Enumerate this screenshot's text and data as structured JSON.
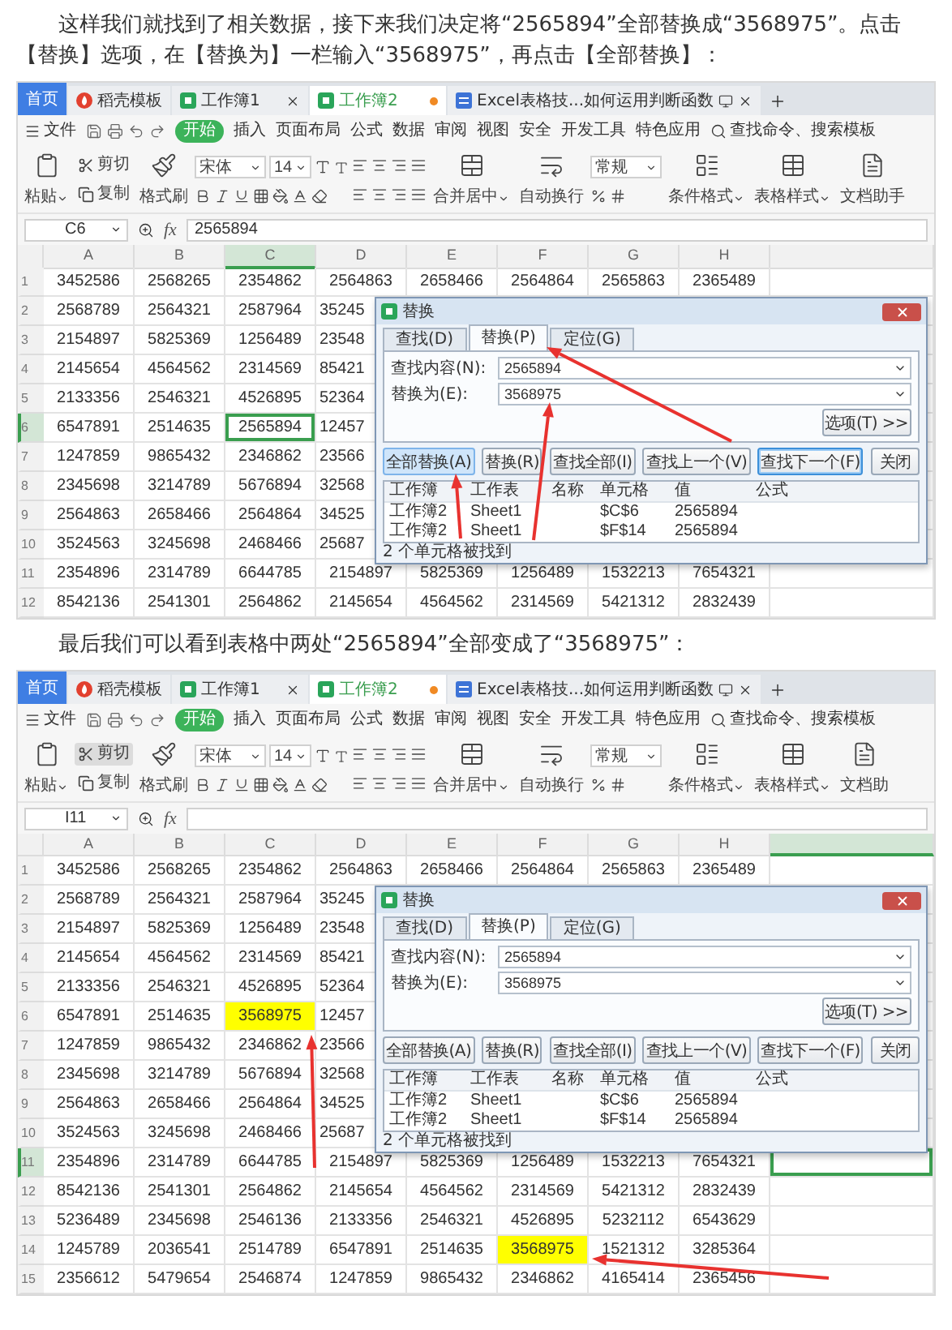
{
  "blocks": [
    {
      "kind": "text",
      "text": "这样我们就找到了相关数据，接下来我们决定将“2565894”全部替换成“3568975”。点击【替换】选项，在【替换为】一栏输入“3568975”，再点击【全部替换】："
    },
    {
      "kind": "screenshot",
      "tabs": [
        {
          "kind": "home",
          "label": "首页",
          "selected": false
        },
        {
          "kind": "docer",
          "label": "稻壳模板",
          "selected": false
        },
        {
          "kind": "sheet",
          "label": "工作簿1",
          "selected": false
        },
        {
          "kind": "sheet",
          "label": "工作簿2",
          "selected": true
        },
        {
          "kind": "doc",
          "label": "Excel表格技...如何运用判断函数",
          "selected": false
        }
      ],
      "menu": {
        "file": "文件",
        "tabs": [
          {
            "label": "开始",
            "selected": true
          },
          {
            "label": "插入",
            "selected": false
          },
          {
            "label": "页面布局",
            "selected": false
          },
          {
            "label": "公式",
            "selected": false
          },
          {
            "label": "数据",
            "selected": false
          },
          {
            "label": "审阅",
            "selected": false
          },
          {
            "label": "视图",
            "selected": false
          },
          {
            "label": "安全",
            "selected": false
          },
          {
            "label": "开发工具",
            "selected": false
          },
          {
            "label": "特色应用",
            "selected": false
          }
        ],
        "search": "查找命令、搜索模板"
      },
      "ribbon": [
        {
          "kind": "big",
          "label": "粘贴",
          "dropdown": true
        },
        {
          "kind": "pair",
          "items": [
            {
              "label": "剪切",
              "hovered": false
            },
            {
              "label": "复制",
              "hovered": false
            }
          ]
        },
        {
          "kind": "big",
          "label": "格式刷",
          "dropdown": false
        },
        {
          "kind": "font",
          "font": "宋体",
          "size": "14"
        },
        {
          "kind": "align"
        },
        {
          "kind": "big",
          "label": "合并居中",
          "dropdown": true
        },
        {
          "kind": "big",
          "label": "自动换行",
          "dropdown": false
        },
        {
          "kind": "number",
          "format": "常规"
        },
        {
          "kind": "big",
          "label": "条件格式",
          "dropdown": true
        },
        {
          "kind": "big",
          "label": "表格样式",
          "dropdown": true
        },
        {
          "kind": "big",
          "label": "文档助手",
          "dropdown": false
        }
      ],
      "name_box": "C6",
      "fx": "fx",
      "formula": "2565894",
      "columns": [
        {
          "label": "A",
          "selected": false
        },
        {
          "label": "B",
          "selected": false
        },
        {
          "label": "C",
          "selected": true
        },
        {
          "label": "D",
          "selected": false
        },
        {
          "label": "E",
          "selected": false
        },
        {
          "label": "F",
          "selected": false
        },
        {
          "label": "G",
          "selected": false
        },
        {
          "label": "H",
          "selected": false
        },
        {
          "selected": false
        }
      ],
      "rows": [
        {
          "label": "1",
          "selected": false,
          "cells": [
            {
              "text": "3452586",
              "selected": false
            },
            {
              "text": "2568265",
              "selected": false
            },
            {
              "text": "2354862",
              "selected": false
            },
            {
              "text": "2564863",
              "selected": false
            },
            {
              "text": "2658466",
              "selected": false
            },
            {
              "text": "2564864",
              "selected": false
            },
            {
              "text": "2565863",
              "selected": false
            },
            {
              "text": "2365489",
              "selected": false
            }
          ]
        },
        {
          "label": "2",
          "selected": false,
          "cells": [
            {
              "text": "2568789",
              "selected": false
            },
            {
              "text": "2564321",
              "selected": false
            },
            {
              "text": "2587964",
              "selected": false
            }
          ],
          "cut_cell": {
            "text": "35245",
            "selected": false
          }
        },
        {
          "label": "3",
          "selected": false,
          "cells": [
            {
              "text": "2154897",
              "selected": false
            },
            {
              "text": "5825369",
              "selected": false
            },
            {
              "text": "1256489",
              "selected": false
            }
          ],
          "cut_cell": {
            "text": "23548",
            "selected": false
          }
        },
        {
          "label": "4",
          "selected": false,
          "cells": [
            {
              "text": "2145654",
              "selected": false
            },
            {
              "text": "4564562",
              "selected": false
            },
            {
              "text": "2314569",
              "selected": false
            }
          ],
          "cut_cell": {
            "text": "85421",
            "selected": false
          }
        },
        {
          "label": "5",
          "selected": false,
          "cells": [
            {
              "text": "2133356",
              "selected": false
            },
            {
              "text": "2546321",
              "selected": false
            },
            {
              "text": "4526895",
              "selected": false
            }
          ],
          "cut_cell": {
            "text": "52364",
            "selected": false
          }
        },
        {
          "label": "6",
          "selected": true,
          "cells": [
            {
              "text": "6547891",
              "selected": false
            },
            {
              "text": "2514635",
              "selected": false
            },
            {
              "text": "2565894",
              "selected": true
            }
          ],
          "cut_cell": {
            "text": "12457",
            "selected": false
          }
        },
        {
          "label": "7",
          "selected": false,
          "cells": [
            {
              "text": "1247859",
              "selected": false
            },
            {
              "text": "9865432",
              "selected": false
            },
            {
              "text": "2346862",
              "selected": false
            }
          ],
          "cut_cell": {
            "text": "23566",
            "selected": false
          }
        },
        {
          "label": "8",
          "selected": false,
          "cells": [
            {
              "text": "2345698",
              "selected": false
            },
            {
              "text": "3214789",
              "selected": false
            },
            {
              "text": "5676894",
              "selected": false
            }
          ],
          "cut_cell": {
            "text": "32568",
            "selected": false
          }
        },
        {
          "label": "9",
          "selected": false,
          "cells": [
            {
              "text": "2564863",
              "selected": false
            },
            {
              "text": "2658466",
              "selected": false
            },
            {
              "text": "2564864",
              "selected": false
            }
          ],
          "cut_cell": {
            "text": "34525",
            "selected": false
          }
        },
        {
          "label": "10",
          "selected": false,
          "cells": [
            {
              "text": "3524563",
              "selected": false
            },
            {
              "text": "3245698",
              "selected": false
            },
            {
              "text": "2468466",
              "selected": false
            }
          ],
          "cut_cell": {
            "text": "25687",
            "selected": false
          }
        },
        {
          "label": "11",
          "selected": false,
          "cells": [
            {
              "text": "2354896",
              "selected": false
            },
            {
              "text": "2314789",
              "selected": false
            },
            {
              "text": "6644785",
              "selected": false
            },
            {
              "text": "2154897",
              "selected": false
            },
            {
              "text": "5825369",
              "selected": false
            },
            {
              "text": "1256489",
              "selected": false
            },
            {
              "text": "1532213",
              "selected": false
            },
            {
              "text": "7654321",
              "selected": false
            }
          ]
        },
        {
          "label": "12",
          "selected": false,
          "cells": [
            {
              "text": "8542136",
              "selected": false
            },
            {
              "text": "2541301",
              "selected": false
            },
            {
              "text": "2564862",
              "selected": false
            },
            {
              "text": "2145654",
              "selected": false
            },
            {
              "text": "4564562",
              "selected": false
            },
            {
              "text": "2314569",
              "selected": false
            },
            {
              "text": "5421312",
              "selected": false
            },
            {
              "text": "2832439",
              "selected": false
            }
          ]
        }
      ],
      "dialog": {
        "title": "替换",
        "tabs": [
          {
            "label": "查找(D)",
            "selected": false
          },
          {
            "label": "替换(P)",
            "selected": true
          },
          {
            "label": "定位(G)",
            "selected": false
          }
        ],
        "fields": [
          {
            "label": "查找内容(N):",
            "value": "2565894"
          },
          {
            "label": "替换为(E):",
            "value": "3568975"
          }
        ],
        "options": "选项(T) >>",
        "buttons": [
          {
            "label": "全部替换(A)",
            "hovered": true,
            "focused": false
          },
          {
            "label": "替换(R)",
            "hovered": false,
            "focused": false
          },
          {
            "label": "查找全部(I)",
            "hovered": false,
            "focused": false
          },
          {
            "label": "查找上一个(V)",
            "hovered": false,
            "focused": false
          },
          {
            "label": "查找下一个(F)",
            "hovered": false,
            "focused": true
          },
          {
            "label": "关闭",
            "hovered": false,
            "focused": false
          }
        ],
        "result_columns": [
          "工作簿",
          "工作表",
          "名称",
          "单元格",
          "值",
          "公式"
        ],
        "results": [
          {
            "workbook": "工作簿2",
            "sheet": "Sheet1",
            "cell": "$C$6",
            "value": "2565894"
          },
          {
            "workbook": "工作簿2",
            "sheet": "Sheet1",
            "cell": "$F$14",
            "value": "2565894"
          }
        ],
        "status": "2 个单元格被找到"
      }
    },
    {
      "kind": "text",
      "text": "最后我们可以看到表格中两处“2565894”全部变成了“3568975”："
    },
    {
      "kind": "screenshot",
      "tabs": [
        {
          "kind": "home",
          "label": "首页",
          "selected": false
        },
        {
          "kind": "docer",
          "label": "稻壳模板",
          "selected": false
        },
        {
          "kind": "sheet",
          "label": "工作簿1",
          "selected": false
        },
        {
          "kind": "sheet",
          "label": "工作簿2",
          "selected": true
        },
        {
          "kind": "doc",
          "label": "Excel表格技...如何运用判断函数",
          "selected": false
        }
      ],
      "menu": {
        "file": "文件",
        "tabs": [
          {
            "label": "开始",
            "selected": true
          },
          {
            "label": "插入",
            "selected": false
          },
          {
            "label": "页面布局",
            "selected": false
          },
          {
            "label": "公式",
            "selected": false
          },
          {
            "label": "数据",
            "selected": false
          },
          {
            "label": "审阅",
            "selected": false
          },
          {
            "label": "视图",
            "selected": false
          },
          {
            "label": "安全",
            "selected": false
          },
          {
            "label": "开发工具",
            "selected": false
          },
          {
            "label": "特色应用",
            "selected": false
          }
        ],
        "search": "查找命令、搜索模板"
      },
      "ribbon": [
        {
          "kind": "big",
          "label": "粘贴",
          "dropdown": true
        },
        {
          "kind": "pair",
          "items": [
            {
              "label": "剪切",
              "hovered": true
            },
            {
              "label": "复制",
              "hovered": false
            }
          ]
        },
        {
          "kind": "big",
          "label": "格式刷",
          "dropdown": false
        },
        {
          "kind": "font",
          "font": "宋体",
          "size": "14"
        },
        {
          "kind": "align"
        },
        {
          "kind": "big",
          "label": "合并居中",
          "dropdown": true
        },
        {
          "kind": "big",
          "label": "自动换行",
          "dropdown": false
        },
        {
          "kind": "number",
          "format": "常规"
        },
        {
          "kind": "big",
          "label": "条件格式",
          "dropdown": true
        },
        {
          "kind": "big",
          "label": "表格样式",
          "dropdown": true
        },
        {
          "kind": "big",
          "label": "文档助",
          "dropdown": false
        }
      ],
      "name_box": "I11",
      "fx": "fx",
      "columns": [
        {
          "label": "A",
          "selected": false
        },
        {
          "label": "B",
          "selected": false
        },
        {
          "label": "C",
          "selected": false
        },
        {
          "label": "D",
          "selected": false
        },
        {
          "label": "E",
          "selected": false
        },
        {
          "label": "F",
          "selected": false
        },
        {
          "label": "G",
          "selected": false
        },
        {
          "label": "H",
          "selected": false
        },
        {
          "selected": true
        }
      ],
      "rows": [
        {
          "label": "1",
          "selected": false,
          "cells": [
            {
              "text": "3452586",
              "selected": false
            },
            {
              "text": "2568265",
              "selected": false
            },
            {
              "text": "2354862",
              "selected": false
            },
            {
              "text": "2564863",
              "selected": false
            },
            {
              "text": "2658466",
              "selected": false
            },
            {
              "text": "2564864",
              "selected": false
            },
            {
              "text": "2565863",
              "selected": false
            },
            {
              "text": "2365489",
              "selected": false
            }
          ]
        },
        {
          "label": "2",
          "selected": false,
          "cells": [
            {
              "text": "2568789",
              "selected": false
            },
            {
              "text": "2564321",
              "selected": false
            },
            {
              "text": "2587964",
              "selected": false
            }
          ],
          "cut_cell": {
            "text": "35245",
            "selected": false
          }
        },
        {
          "label": "3",
          "selected": false,
          "cells": [
            {
              "text": "2154897",
              "selected": false
            },
            {
              "text": "5825369",
              "selected": false
            },
            {
              "text": "1256489",
              "selected": false
            }
          ],
          "cut_cell": {
            "text": "23548",
            "selected": false
          }
        },
        {
          "label": "4",
          "selected": false,
          "cells": [
            {
              "text": "2145654",
              "selected": false
            },
            {
              "text": "4564562",
              "selected": false
            },
            {
              "text": "2314569",
              "selected": false
            }
          ],
          "cut_cell": {
            "text": "85421",
            "selected": false
          }
        },
        {
          "label": "5",
          "selected": false,
          "cells": [
            {
              "text": "2133356",
              "selected": false
            },
            {
              "text": "2546321",
              "selected": false
            },
            {
              "text": "4526895",
              "selected": false
            }
          ],
          "cut_cell": {
            "text": "52364",
            "selected": false
          }
        },
        {
          "label": "6",
          "selected": false,
          "cells": [
            {
              "text": "6547891",
              "selected": false
            },
            {
              "text": "2514635",
              "selected": false
            },
            {
              "text": "3568975",
              "selected": false,
              "color": "#ffff00"
            }
          ],
          "cut_cell": {
            "text": "12457",
            "selected": false
          }
        },
        {
          "label": "7",
          "selected": false,
          "cells": [
            {
              "text": "1247859",
              "selected": false
            },
            {
              "text": "9865432",
              "selected": false
            },
            {
              "text": "2346862",
              "selected": false
            }
          ],
          "cut_cell": {
            "text": "23566",
            "selected": false
          }
        },
        {
          "label": "8",
          "selected": false,
          "cells": [
            {
              "text": "2345698",
              "selected": false
            },
            {
              "text": "3214789",
              "selected": false
            },
            {
              "text": "5676894",
              "selected": false
            }
          ],
          "cut_cell": {
            "text": "32568",
            "selected": false
          }
        },
        {
          "label": "9",
          "selected": false,
          "cells": [
            {
              "text": "2564863",
              "selected": false
            },
            {
              "text": "2658466",
              "selected": false
            },
            {
              "text": "2564864",
              "selected": false
            }
          ],
          "cut_cell": {
            "text": "34525",
            "selected": false
          }
        },
        {
          "label": "10",
          "selected": false,
          "cells": [
            {
              "text": "3524563",
              "selected": false
            },
            {
              "text": "3245698",
              "selected": false
            },
            {
              "text": "2468466",
              "selected": false
            }
          ],
          "cut_cell": {
            "text": "25687",
            "selected": false
          }
        },
        {
          "label": "11",
          "selected": true,
          "cells": [
            {
              "text": "2354896",
              "selected": false
            },
            {
              "text": "2314789",
              "selected": false
            },
            {
              "text": "6644785",
              "selected": false
            },
            {
              "text": "2154897",
              "selected": false
            },
            {
              "text": "5825369",
              "selected": false
            },
            {
              "text": "1256489",
              "selected": false
            },
            {
              "text": "1532213",
              "selected": false
            },
            {
              "text": "7654321",
              "selected": false
            },
            {
              "selected": true
            }
          ]
        },
        {
          "label": "12",
          "selected": false,
          "cells": [
            {
              "text": "8542136",
              "selected": false
            },
            {
              "text": "2541301",
              "selected": false
            },
            {
              "text": "2564862",
              "selected": false
            },
            {
              "text": "2145654",
              "selected": false
            },
            {
              "text": "4564562",
              "selected": false
            },
            {
              "text": "2314569",
              "selected": false
            },
            {
              "text": "5421312",
              "selected": false
            },
            {
              "text": "2832439",
              "selected": false
            }
          ]
        },
        {
          "label": "13",
          "selected": false,
          "cells": [
            {
              "text": "5236489",
              "selected": false
            },
            {
              "text": "2345698",
              "selected": false
            },
            {
              "text": "2546136",
              "selected": false
            },
            {
              "text": "2133356",
              "selected": false
            },
            {
              "text": "2546321",
              "selected": false
            },
            {
              "text": "4526895",
              "selected": false
            },
            {
              "text": "5232112",
              "selected": false
            },
            {
              "text": "6543629",
              "selected": false
            }
          ]
        },
        {
          "label": "14",
          "selected": false,
          "cells": [
            {
              "text": "1245789",
              "selected": false
            },
            {
              "text": "2036541",
              "selected": false
            },
            {
              "text": "2514789",
              "selected": false
            },
            {
              "text": "6547891",
              "selected": false
            },
            {
              "text": "2514635",
              "selected": false
            },
            {
              "text": "3568975",
              "selected": false,
              "color": "#ffff00"
            },
            {
              "text": "1521312",
              "selected": false
            },
            {
              "text": "3285364",
              "selected": false
            }
          ]
        },
        {
          "label": "15",
          "selected": false,
          "cells": [
            {
              "text": "2356612",
              "selected": false
            },
            {
              "text": "5479654",
              "selected": false
            },
            {
              "text": "2546874",
              "selected": false
            },
            {
              "text": "1247859",
              "selected": false
            },
            {
              "text": "9865432",
              "selected": false
            },
            {
              "text": "2346862",
              "selected": false
            },
            {
              "text": "4165414",
              "selected": false
            },
            {
              "text": "2365456",
              "selected": false
            }
          ]
        }
      ],
      "dialog": {
        "title": "替换",
        "tabs": [
          {
            "label": "查找(D)",
            "selected": false
          },
          {
            "label": "替换(P)",
            "selected": true
          },
          {
            "label": "定位(G)",
            "selected": false
          }
        ],
        "fields": [
          {
            "label": "查找内容(N):",
            "value": "2565894"
          },
          {
            "label": "替换为(E):",
            "value": "3568975"
          }
        ],
        "options": "选项(T) >>",
        "buttons": [
          {
            "label": "全部替换(A)",
            "hovered": false,
            "focused": false
          },
          {
            "label": "替换(R)",
            "hovered": false,
            "focused": false
          },
          {
            "label": "查找全部(I)",
            "hovered": false,
            "focused": false
          },
          {
            "label": "查找上一个(V)",
            "hovered": false,
            "focused": false
          },
          {
            "label": "查找下一个(F)",
            "hovered": false,
            "focused": false
          },
          {
            "label": "关闭",
            "hovered": false,
            "focused": false
          }
        ],
        "result_columns": [
          "工作簿",
          "工作表",
          "名称",
          "单元格",
          "值",
          "公式"
        ],
        "results": [
          {
            "workbook": "工作簿2",
            "sheet": "Sheet1",
            "cell": "$C$6",
            "value": "2565894"
          },
          {
            "workbook": "工作簿2",
            "sheet": "Sheet1",
            "cell": "$F$14",
            "value": "2565894"
          }
        ],
        "status": "2 个单元格被找到"
      }
    }
  ]
}
